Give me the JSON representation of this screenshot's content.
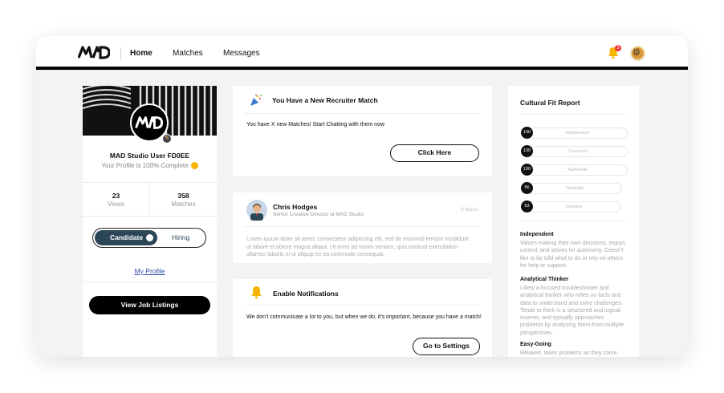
{
  "nav": {
    "logo_text": "MAD",
    "links": [
      "Home",
      "Matches",
      "Messages"
    ],
    "notification_count": "3"
  },
  "profile": {
    "name": "MAD Studio User FD0EE",
    "completeness": "Your Profile is 100% Complete",
    "views_count": "23",
    "views_label": "Views",
    "matches_count": "358",
    "matches_label": "Matches",
    "toggle_on": "Candidate",
    "toggle_off": "Hiring",
    "my_profile": "My Profile",
    "view_jobs": "View Job Listings"
  },
  "recruiter_card": {
    "title": "You Have a New Recruiter Match",
    "text": "You have X new Matches! Start Chatting with them now",
    "button": "Click Here"
  },
  "message_card": {
    "name": "Chris Hodges",
    "role": "Senior Creative Director at MAD Studio",
    "time": "3 hours",
    "body": "Lorem ipsum dolor sit amet, consectetur adipiscing elit, sed do eiusmod tempor incididunt ut labore et dolore magna aliqua. Ut enim ad minim veniam, quis nostrud exercitation ullamco laboris ni ut aliquip ex ea commodo consequat."
  },
  "notify_card": {
    "title": "Enable Notifications",
    "text": "We don't communicate a lot to you, but when we do, it's important, because you have a match!",
    "button": "Go to Settings"
  },
  "culture": {
    "title": "Cultural Fit Report",
    "traits": [
      {
        "score": "100",
        "label": "Independent"
      },
      {
        "score": "100",
        "label": "Generous"
      },
      {
        "score": "100",
        "label": "Agreeable"
      },
      {
        "score": "56",
        "label": "Flexibility"
      },
      {
        "score": "53",
        "label": "Genuine"
      }
    ],
    "sections": [
      {
        "title": "Independent",
        "text": "Values making their own decisions, enjoys control, and strives for autonomy. Doesn't like to be told what to do or rely on others for help or support."
      },
      {
        "title": "Analytical Thinker",
        "text": "Likely a focused troubleshooter and analytical thinker who relies on facts and data to understand and solve challenges. Tends to think in a structured and logical manner, and typically approaches problems by analyzing them from multiple perspectives."
      },
      {
        "title": "Easy-Going",
        "text": "Relaxed, takes problems as they come, very"
      }
    ]
  },
  "colors": {
    "accent": "#2b4757",
    "link": "#2a4ea8",
    "black": "#000000",
    "badge": "#e33333"
  }
}
